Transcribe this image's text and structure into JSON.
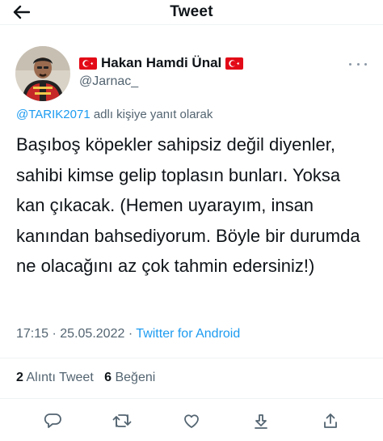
{
  "header": {
    "title": "Tweet",
    "back_icon": "arrow-left-icon"
  },
  "author": {
    "name": "Hakan Hamdi Ünal",
    "handle": "@Jarnac_",
    "flag_icon": "turkey-flag-icon"
  },
  "reply_to": {
    "mention": "@TARIK2071",
    "suffix": "adlı kişiye yanıt olarak"
  },
  "tweet": {
    "text": "Başıboş köpekler sahipsiz değil diyenler, sahibi kimse gelip toplasın bunları. Yoksa kan çıkacak. (Hemen uyarayım, insan kanından bahsediyorum. Böyle bir durumda ne olacağını az çok tahmin edersiniz!)",
    "time": "17:15",
    "separator": "·",
    "date": "25.05.2022",
    "source": "Twitter for Android"
  },
  "stats": {
    "quote_count": "2",
    "quote_label": "Alıntı Tweet",
    "like_count": "6",
    "like_label": "Beğeni"
  },
  "actions": [
    "reply-icon",
    "retweet-icon",
    "like-icon",
    "download-icon",
    "share-icon"
  ],
  "colors": {
    "link": "#1d9bf0",
    "muted": "#536471",
    "text": "#0f1419",
    "flag_red": "#e30a17"
  }
}
